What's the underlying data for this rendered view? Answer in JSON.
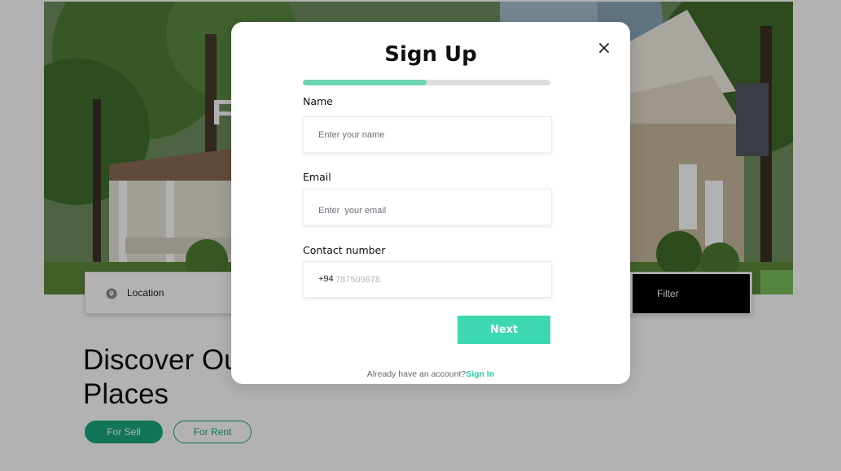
{
  "background": {
    "hero_letter": "F",
    "search": {
      "location_label": "Location",
      "filter_label": "Filter"
    },
    "heading_line1": "Discover Ou",
    "heading_line2": "Places",
    "pills": {
      "sell": "For Sell",
      "rent": "For Rent"
    }
  },
  "modal": {
    "title": "Sign Up",
    "progress": 0.5,
    "name": {
      "label": "Name",
      "placeholder": "Enter your name"
    },
    "email": {
      "label": "Email",
      "placeholder": "Enter  your email"
    },
    "contact": {
      "label": "Contact number",
      "prefix": "+94",
      "placeholder": "787509678"
    },
    "next_label": "Next",
    "footer_text": "Already have an account?",
    "signin_label": "Sign In"
  },
  "colors": {
    "accent": "#3dd8b0",
    "progress_fill": "#6dd3b3",
    "pill_green": "#1aa67f"
  }
}
